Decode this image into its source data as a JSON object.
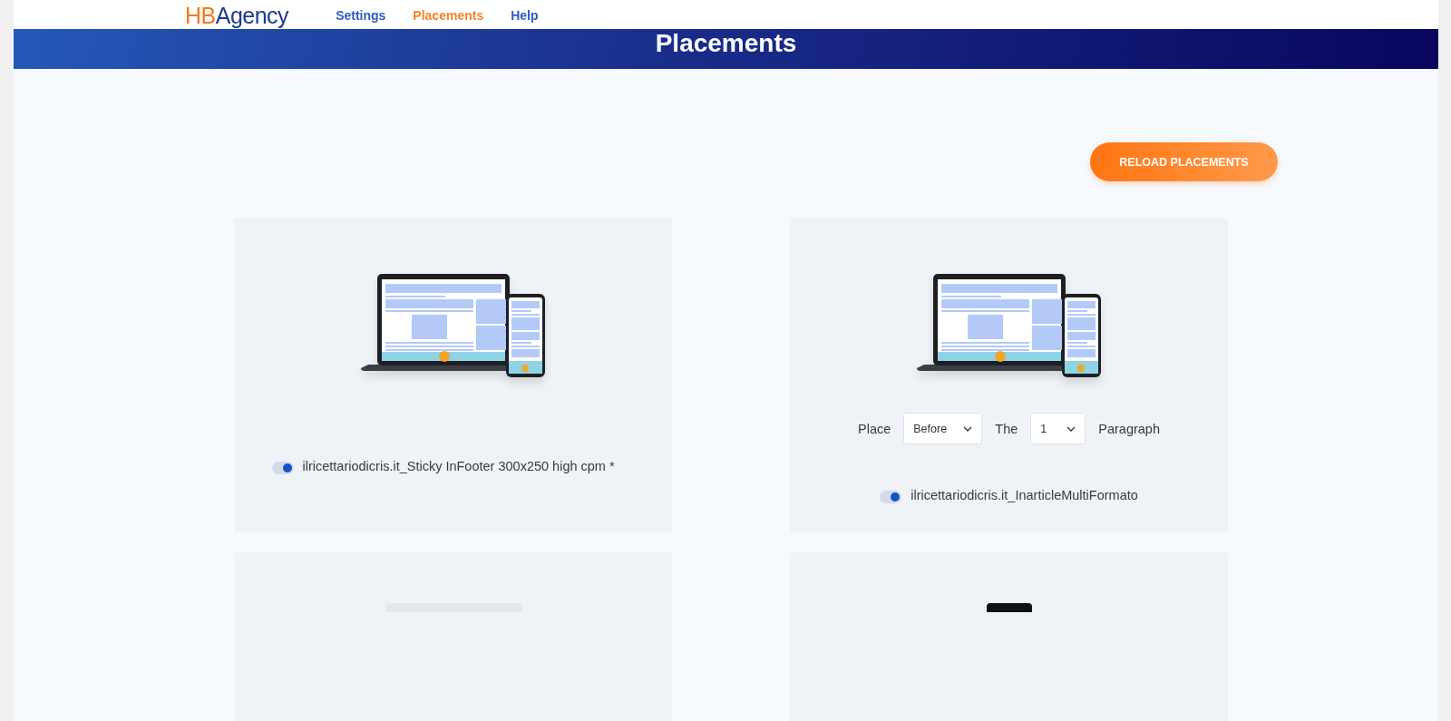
{
  "header": {
    "logo": {
      "mark": "HB",
      "name": "Agency"
    },
    "nav": [
      {
        "label": "Settings",
        "selected": false
      },
      {
        "label": "Placements",
        "selected": true
      },
      {
        "label": "Help",
        "selected": false
      }
    ]
  },
  "banner": {
    "title": "Placements"
  },
  "reload_button": "RELOAD PLACEMENTS",
  "placements": [
    {
      "kind": "plain",
      "name": "ilricettariodicris.it_Sticky InFooter 300x250 high cpm *",
      "on": true
    },
    {
      "kind": "paragraph",
      "place_label": "Place",
      "position": "Before",
      "the_label": "The",
      "number": "1",
      "unit_label": "Paragraph",
      "name": "ilricettariodicris.it_InarticleMultiFormato",
      "on": true
    },
    {
      "kind": "partial"
    },
    {
      "kind": "partial"
    }
  ]
}
